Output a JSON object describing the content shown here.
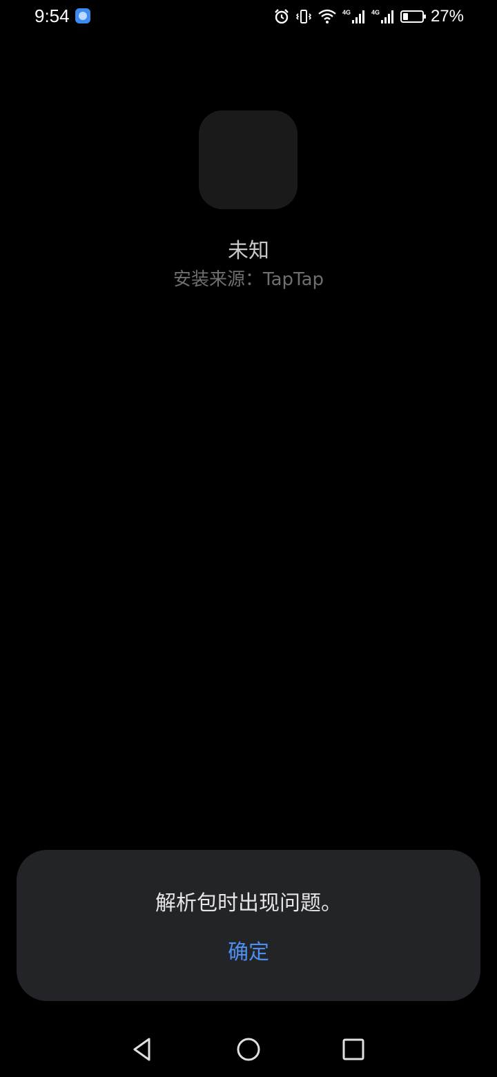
{
  "status_bar": {
    "time": "9:54",
    "notification_icon": "app-notification-icon",
    "icons": [
      "alarm-icon",
      "vibrate-icon",
      "wifi-icon",
      "signal-4g-icon",
      "signal-4g-icon"
    ],
    "signal_1_label": "4G",
    "signal_2_label": "4G",
    "battery_level": 0.27,
    "battery_percent": "27%"
  },
  "app": {
    "name": "未知",
    "install_source": "安装来源：TapTap"
  },
  "dialog": {
    "message": "解析包时出现问题。",
    "confirm_label": "确定",
    "background_color": "#232427",
    "confirm_color": "#4d8ff0"
  },
  "nav_bar": {
    "buttons": [
      "back-icon",
      "home-icon",
      "recents-icon"
    ]
  }
}
